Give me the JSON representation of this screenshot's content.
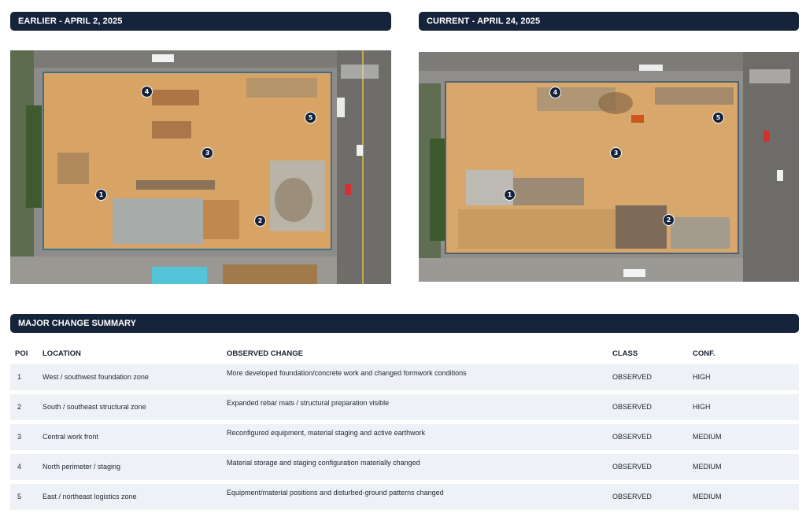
{
  "panels": {
    "earlier_title": "EARLIER - APRIL 2, 2025",
    "current_title": "CURRENT - APRIL 24, 2025",
    "earlier_markers": [
      "1",
      "2",
      "3",
      "4",
      "5"
    ],
    "current_markers": [
      "1",
      "2",
      "3",
      "4",
      "5"
    ]
  },
  "summary": {
    "title": "MAJOR CHANGE SUMMARY",
    "columns": [
      "POI",
      "LOCATION",
      "OBSERVED CHANGE",
      "CLASS",
      "CONF."
    ],
    "rows": [
      {
        "poi": "1",
        "location": "West / southwest foundation zone",
        "change": "More developed foundation/concrete work and changed formwork conditions",
        "class": "OBSERVED",
        "conf": "HIGH"
      },
      {
        "poi": "2",
        "location": "South / southeast structural zone",
        "change": "Expanded rebar mats / structural preparation visible",
        "class": "OBSERVED",
        "conf": "HIGH"
      },
      {
        "poi": "3",
        "location": "Central work front",
        "change": "Reconfigured equipment, material staging and active earthwork",
        "class": "OBSERVED",
        "conf": "MEDIUM"
      },
      {
        "poi": "4",
        "location": "North perimeter / staging",
        "change": "Material storage and staging configuration materially changed",
        "class": "OBSERVED",
        "conf": "MEDIUM"
      },
      {
        "poi": "5",
        "location": "East / northeast logistics zone",
        "change": "Equipment/material positions and disturbed-ground patterns changed",
        "class": "OBSERVED",
        "conf": "MEDIUM"
      }
    ]
  },
  "colors": {
    "header_bg": "#15243b",
    "row_shade": "#eef1f5",
    "dirt": "#d9a46a",
    "pavement": "#8f8f8c"
  }
}
